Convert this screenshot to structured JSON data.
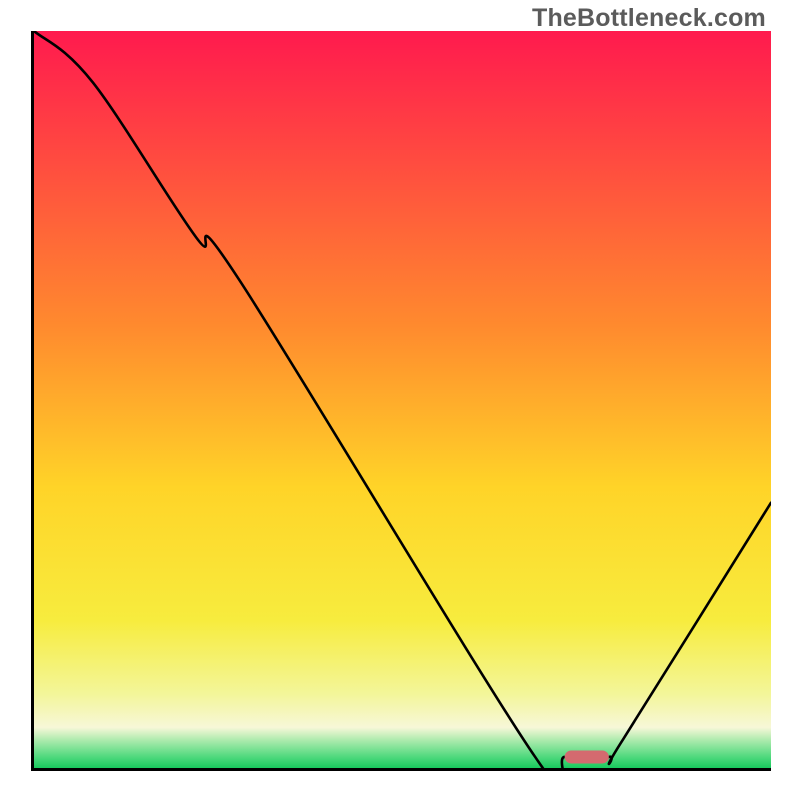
{
  "watermark": "TheBottleneck.com",
  "chart_data": {
    "type": "line",
    "title": "",
    "xlabel": "",
    "ylabel": "",
    "xlim": [
      0,
      100
    ],
    "ylim": [
      0,
      100
    ],
    "grid": false,
    "legend": false,
    "series": [
      {
        "name": "bottleneck-curve",
        "x": [
          0,
          8,
          22,
          28,
          68,
          72,
          78,
          80,
          100
        ],
        "y": [
          100,
          93,
          72,
          66,
          1.5,
          1.5,
          1.5,
          4,
          36
        ]
      }
    ],
    "marker": {
      "name": "recommended-range-marker",
      "x_start": 72,
      "x_end": 78,
      "y": 1.5,
      "color": "#d46a6f"
    },
    "background_gradient": {
      "stops": [
        {
          "offset": 0,
          "color": "#ff1a4e"
        },
        {
          "offset": 0.4,
          "color": "#ff8a2e"
        },
        {
          "offset": 0.62,
          "color": "#ffd428"
        },
        {
          "offset": 0.8,
          "color": "#f7ec3e"
        },
        {
          "offset": 0.9,
          "color": "#f3f69a"
        },
        {
          "offset": 0.945,
          "color": "#f7f7d8"
        },
        {
          "offset": 0.96,
          "color": "#b6ecb2"
        },
        {
          "offset": 0.985,
          "color": "#4fd97d"
        },
        {
          "offset": 1.0,
          "color": "#19c95d"
        }
      ]
    }
  }
}
